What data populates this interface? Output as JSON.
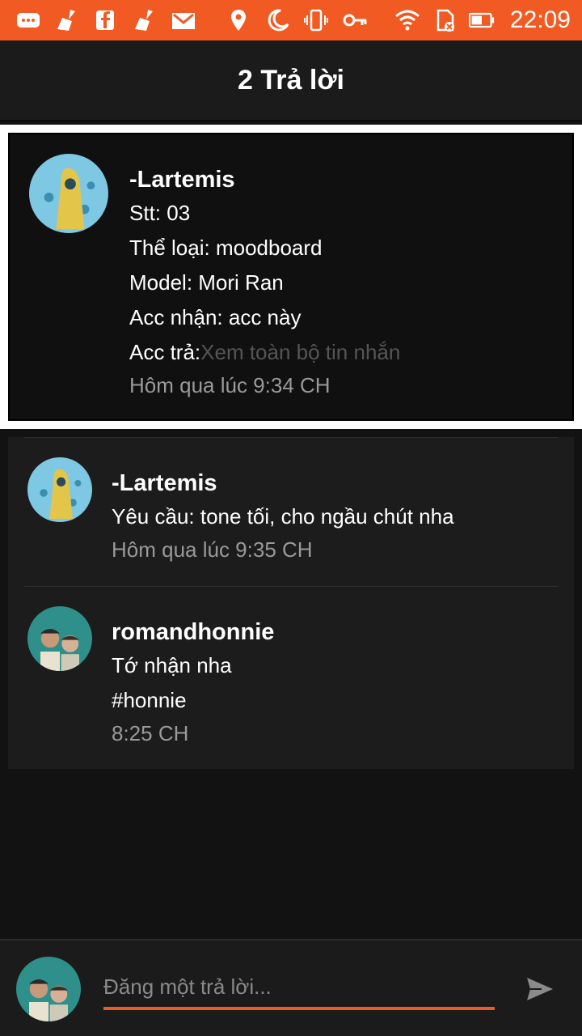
{
  "status_bar": {
    "time": "22:09",
    "icons": [
      "chat-icon",
      "broom-icon",
      "facebook-icon",
      "broom-icon",
      "gmail-icon",
      "location-icon",
      "moon-icon",
      "vibrate-icon",
      "key-icon",
      "wifi-icon",
      "sd-card-icon",
      "battery-icon"
    ]
  },
  "header": {
    "title": "2 Trả lời"
  },
  "post": {
    "author": "-Lartemis",
    "lines": [
      "Stt: 03",
      "Thể loại: moodboard",
      "Model: Mori Ran",
      "Acc nhận: acc này"
    ],
    "truncated_prefix": "Acc trả:",
    "see_more": "Xem toàn bộ tin nhắn",
    "time": "Hôm qua lúc 9:34 CH"
  },
  "replies": [
    {
      "author": "-Lartemis",
      "lines": [
        "Yêu cầu: tone tối, cho ngầu chút nha"
      ],
      "time": "Hôm qua lúc 9:35 CH"
    },
    {
      "author": "romandhonnie",
      "lines": [
        "Tớ nhận nha",
        "#honnie"
      ],
      "time": "8:25 CH"
    }
  ],
  "composer": {
    "placeholder": "Đăng một trả lời..."
  },
  "colors": {
    "accent": "#f15a22",
    "background": "#121212",
    "card": "#1c1c1c"
  }
}
